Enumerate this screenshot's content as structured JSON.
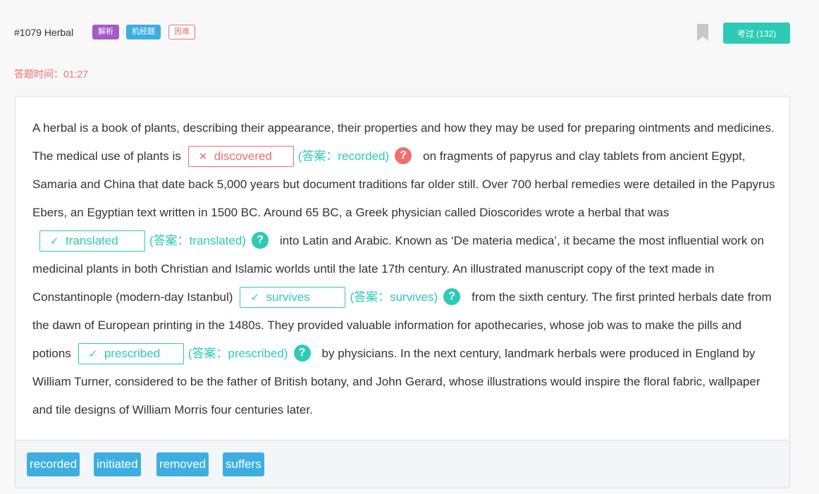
{
  "header": {
    "title": "#1079 Herbal",
    "tags": [
      "解析",
      "机经题",
      "困难"
    ],
    "taken_label": "考过 (132)"
  },
  "timer": {
    "label": "答题时间：01:27"
  },
  "passage": {
    "p0": "A herbal is a book of plants, describing their appearance, their properties and how they may be used for preparing ointments and medicines. The medical use of plants is",
    "p1": "on fragments of papyrus and clay tablets from ancient Egypt, Samaria and China that date back 5,000 years but document traditions far older still. Over 700 herbal remedies were detailed in the Papyrus Ebers, an Egyptian text written in 1500 BC. Around 65 BC, a Greek physician called Dioscorides wrote a herbal that was",
    "p2": "into Latin and Arabic. Known as ‘De materia medica’, it became the most influential work on medicinal plants in both Christian and Islamic worlds until the late 17th century. An illustrated manuscript copy of the text made in Constantinople (modern-day Istanbul)",
    "p3": "from the sixth century. The first printed herbals date from the dawn of European printing in the 1480s. They provided valuable information for apothecaries, whose job was to make the pills and potions",
    "p4": "by physicians. In the next century, landmark herbals were produced in England by William Turner, considered to be the father of British botany, and John Gerard, whose illustrations would inspire the floral fabric, wallpaper and tile designs of William Morris four centuries later.",
    "blanks": [
      {
        "user_answer": "discovered",
        "answer_text": "(答案：recorded)",
        "mark": "✕",
        "help": "?"
      },
      {
        "user_answer": "translated",
        "answer_text": "(答案：translated)",
        "mark": "✓",
        "help": "?"
      },
      {
        "user_answer": "survives",
        "answer_text": "(答案：survives)",
        "mark": "✓",
        "help": "?"
      },
      {
        "user_answer": "prescribed",
        "answer_text": "(答案：prescribed)",
        "mark": "✓",
        "help": "?"
      }
    ]
  },
  "options": [
    "recorded",
    "initiated",
    "removed",
    "suffers"
  ],
  "colors": {
    "correct": "#2dcbb5",
    "wrong": "#ef6f6f",
    "option_bg": "#3daee0",
    "tag_purple": "#a35bc6",
    "tag_blue": "#3daee0"
  }
}
